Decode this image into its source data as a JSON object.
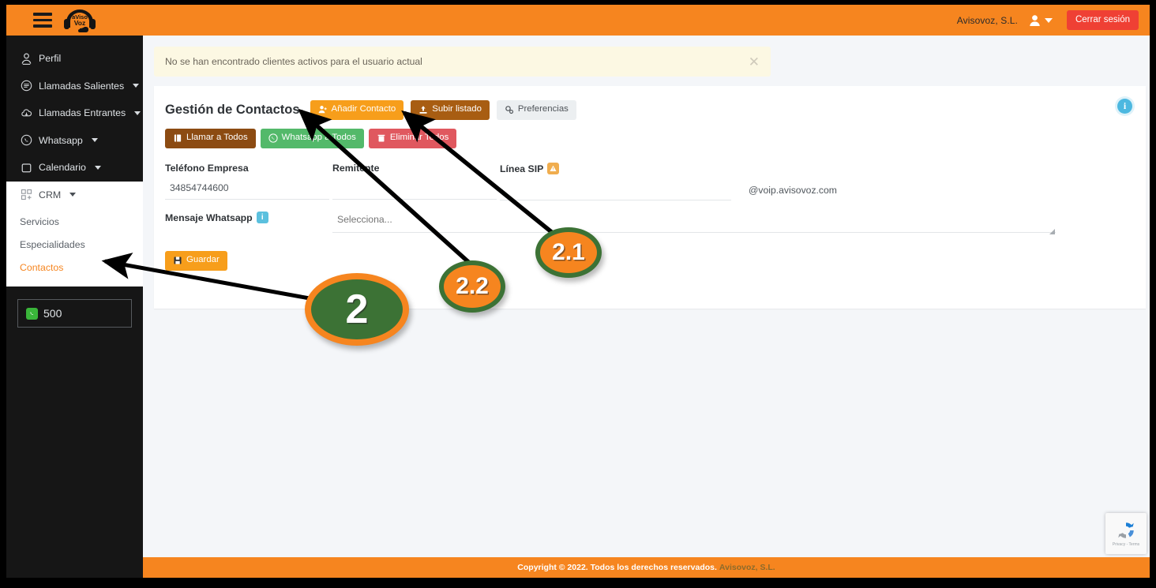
{
  "topbar": {
    "menu_icon": "hamburger-icon",
    "logo_text": "aVisoVoz",
    "company": "Avisovoz, S.L.",
    "user_icon": "user-icon",
    "logout_label": "Cerrar sesión"
  },
  "sidebar": {
    "items": [
      {
        "label": "Perfil",
        "icon": "user-profile-icon",
        "caret": false
      },
      {
        "label": "Llamadas Salientes",
        "icon": "outgoing-calls-icon",
        "caret": true
      },
      {
        "label": "Llamadas Entrantes",
        "icon": "incoming-calls-icon",
        "caret": true
      },
      {
        "label": "Whatsapp",
        "icon": "whatsapp-icon",
        "caret": true
      },
      {
        "label": "Calendario",
        "icon": "calendar-icon",
        "caret": true
      },
      {
        "label": "CRM",
        "icon": "crm-grid-icon",
        "caret": true
      }
    ],
    "crm_submenu": [
      {
        "label": "Servicios",
        "active": false
      },
      {
        "label": "Especialidades",
        "active": false
      },
      {
        "label": "Contactos",
        "active": true
      }
    ],
    "whatsapp_credit": {
      "icon": "whatsapp-icon",
      "value": "500"
    }
  },
  "alert": {
    "message": "No se han encontrado clientes activos para el usuario actual",
    "close_icon": "close-icon"
  },
  "content": {
    "title": "Gestión de Contactos",
    "header_buttons": [
      {
        "label": "Añadir Contacto",
        "icon": "add-user-icon",
        "style": "orange"
      },
      {
        "label": "Subir listado",
        "icon": "upload-icon",
        "style": "brown"
      },
      {
        "label": "Preferencias",
        "icon": "gears-icon",
        "style": "light"
      }
    ],
    "action_buttons": [
      {
        "label": "Llamar a Todos",
        "icon": "phone-icon",
        "style": "darkbrown"
      },
      {
        "label": "Whatsapp a Todos",
        "icon": "whatsapp-icon",
        "style": "green"
      },
      {
        "label": "Eliminar Todos",
        "icon": "trash-icon",
        "style": "red"
      }
    ],
    "info_icon": "info-icon",
    "info_icon_label": "i",
    "fields": {
      "telefono_empresa": {
        "label": "Teléfono Empresa",
        "value": "34854744600",
        "placeholder": ""
      },
      "remitente": {
        "label": "Remitente",
        "value": "",
        "placeholder": ""
      },
      "linea_sip": {
        "label": "Línea SIP",
        "badge_icon": "warning-icon",
        "value": "",
        "placeholder": "",
        "suffix": "@voip.avisovoz.com"
      },
      "mensaje_whatsapp": {
        "label": "Mensaje Whatsapp",
        "badge_icon": "info-icon",
        "value": "",
        "placeholder": ""
      },
      "plantilla_select": {
        "value": "",
        "placeholder": "Selecciona..."
      }
    },
    "save_button": {
      "label": "Guardar",
      "icon": "save-icon"
    }
  },
  "footer": {
    "copyright": "Copyright © 2022. Todos los derechos reservados.",
    "brand": "Avisovoz, S.L."
  },
  "recaptcha": {
    "icon": "recaptcha-icon",
    "text": "Privacy - Terms"
  },
  "annotations": [
    {
      "id": "2",
      "label": "2",
      "points_to": "sidebar-item-contactos"
    },
    {
      "id": "2.2",
      "label": "2.2",
      "points_to": "add-contact-button"
    },
    {
      "id": "2.1",
      "label": "2.1",
      "points_to": "upload-list-button"
    }
  ],
  "colors": {
    "accent_orange": "#f6851f",
    "logout_red": "#ef4034",
    "sidebar_dark": "#161616",
    "annotation_green": "#3c7235",
    "alert_bg": "#fcf8e3"
  }
}
